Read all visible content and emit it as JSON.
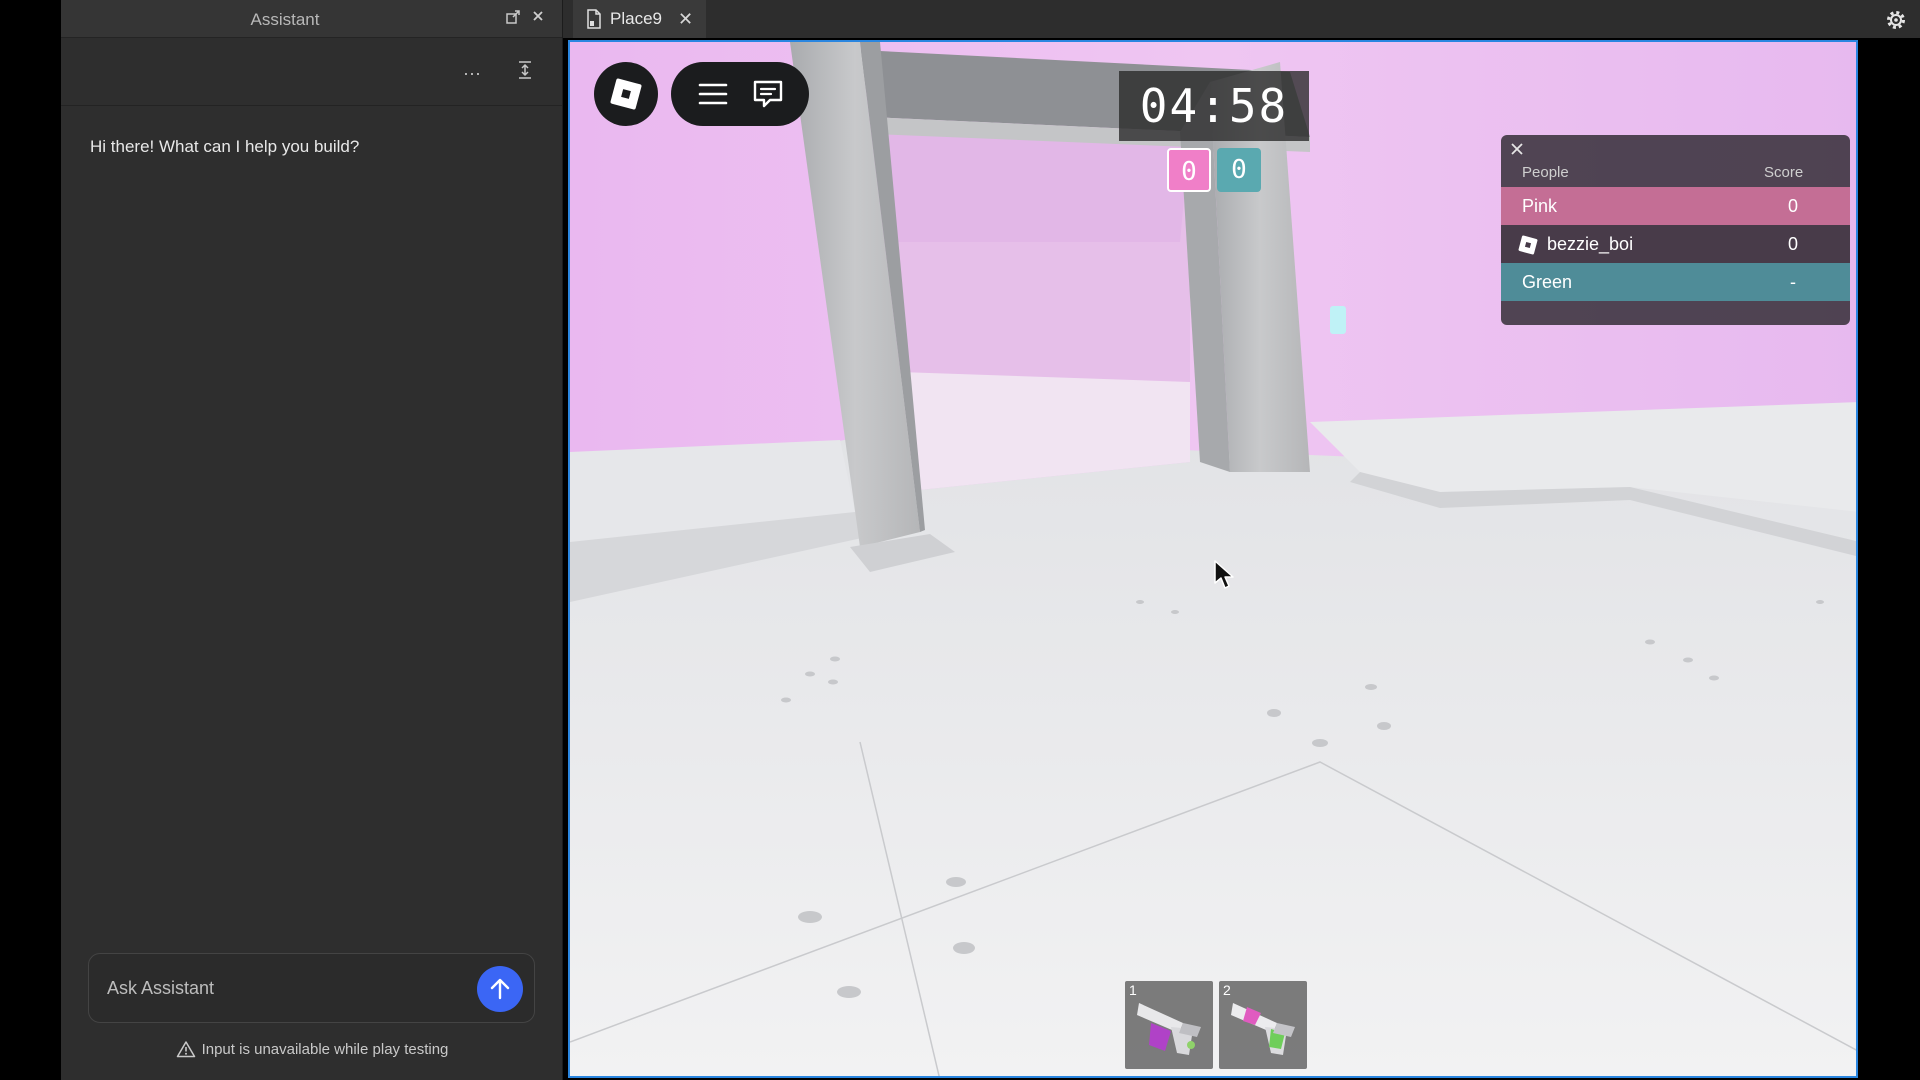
{
  "assistant": {
    "title": "Assistant",
    "icons": [
      "pop-out-icon",
      "close-icon",
      "more-options-icon",
      "collapse-icon"
    ],
    "more_label": "···",
    "greeting": "Hi there! What can I help you build?",
    "input_placeholder": "Ask Assistant",
    "warning": "Input is unavailable while play testing"
  },
  "tabs": [
    {
      "label": "Place9",
      "icon": "document-icon",
      "active": true
    }
  ],
  "game": {
    "timer": "04:58",
    "team_scores": [
      {
        "team": "pink",
        "value": "0",
        "color": "#f07fc8"
      },
      {
        "team": "green",
        "value": "0",
        "color": "#5aa9b0"
      }
    ],
    "leaderboard": {
      "header_people": "People",
      "header_score": "Score",
      "rows": [
        {
          "name": "Pink",
          "score": "0",
          "color": "#c46e95"
        },
        {
          "name": "bezzie_boi",
          "score": "0",
          "icon": "roblox-player-icon"
        },
        {
          "name": "Green",
          "score": "-",
          "color": "#4f8c98"
        }
      ]
    },
    "hotbar": [
      {
        "slot": "1",
        "icon": "pink-paint-blaster-icon"
      },
      {
        "slot": "2",
        "icon": "green-paint-blaster-icon"
      }
    ]
  },
  "colors": {
    "accent": "#3b66f5",
    "viewport_border": "#2a86e0",
    "wall_pink": "#e9bff0"
  }
}
